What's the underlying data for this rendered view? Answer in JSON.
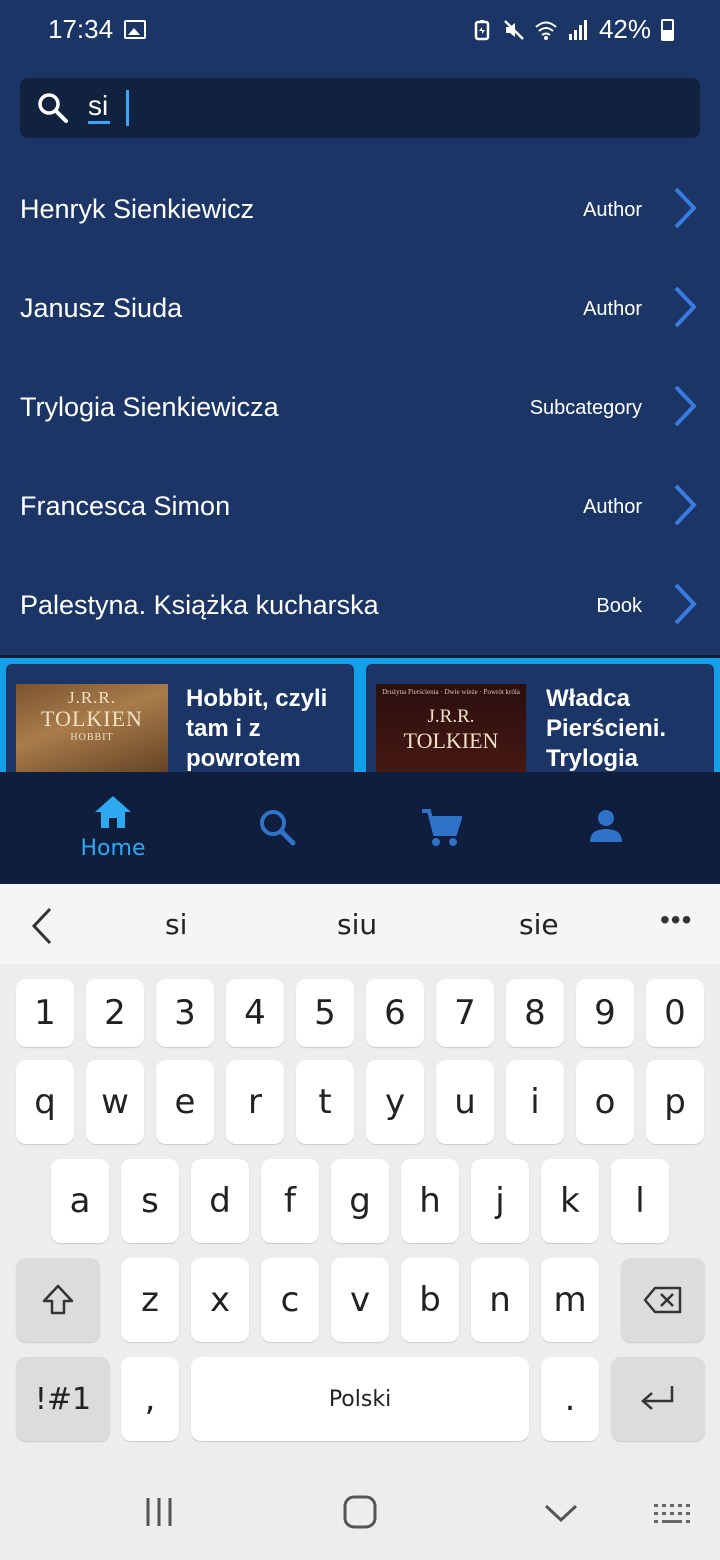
{
  "status_bar": {
    "time": "17:34",
    "battery": "42%",
    "icons": [
      "gallery-icon",
      "battery-saver-icon",
      "mute-icon",
      "wifi-icon",
      "signal-icon",
      "battery-icon"
    ]
  },
  "search": {
    "query": "si",
    "icon": "search-icon"
  },
  "results": [
    {
      "title": "Henryk Sienkiewicz",
      "type": "Author"
    },
    {
      "title": "Janusz Siuda",
      "type": "Author"
    },
    {
      "title": "Trylogia Sienkiewicza",
      "type": "Subcategory"
    },
    {
      "title": "Francesca Simon",
      "type": "Author"
    },
    {
      "title": "Palestyna. Książka kucharska",
      "type": "Book"
    }
  ],
  "books": [
    {
      "title": "Hobbit, czyli tam i z powrotem",
      "cover_author": "J.R.R.",
      "cover_name": "TOLKIEN",
      "cover_sub": "HOBBIT"
    },
    {
      "title": "Władca Pierścieni. Trylogia",
      "cover_top": "Drużyna Pierścienia · Dwie wieże · Powrót króla",
      "cover_author": "J.R.R.",
      "cover_name": "TOLKIEN"
    }
  ],
  "bottom_nav": {
    "home_label": "Home",
    "items": [
      "home-icon",
      "search-icon",
      "cart-icon",
      "profile-icon"
    ],
    "active_color": "#2ea8f0"
  },
  "keyboard": {
    "suggestions": [
      "si",
      "siu",
      "sie"
    ],
    "more": "•••",
    "numbers": [
      "1",
      "2",
      "3",
      "4",
      "5",
      "6",
      "7",
      "8",
      "9",
      "0"
    ],
    "row1": [
      "q",
      "w",
      "e",
      "r",
      "t",
      "y",
      "u",
      "i",
      "o",
      "p"
    ],
    "row2": [
      "a",
      "s",
      "d",
      "f",
      "g",
      "h",
      "j",
      "k",
      "l"
    ],
    "row3": [
      "z",
      "x",
      "c",
      "v",
      "b",
      "n",
      "m"
    ],
    "symbols_label": "!#1",
    "comma": ",",
    "space_label": "Polski",
    "period": "."
  },
  "colors": {
    "background": "#1b3566",
    "accent": "#2ea8f0",
    "chevron": "#3a7be0"
  }
}
